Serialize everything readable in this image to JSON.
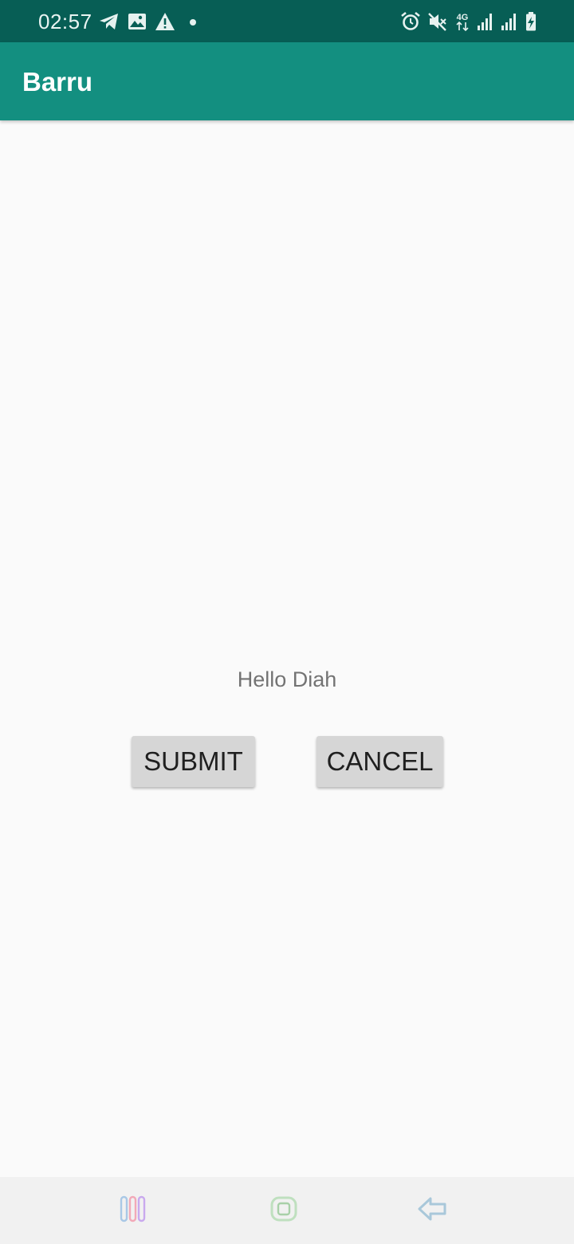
{
  "status_bar": {
    "time": "02:57",
    "network_label": "4G",
    "left_icons": [
      "telegram-icon",
      "image-icon",
      "warning-icon",
      "dot-icon"
    ],
    "right_icons": [
      "alarm-icon",
      "mute-icon",
      "network-4g-icon",
      "signal-icon",
      "signal-icon",
      "battery-charging-icon"
    ]
  },
  "app_bar": {
    "title": "Barru"
  },
  "main": {
    "greeting": "Hello Diah",
    "submit_label": "SUBMIT",
    "cancel_label": "CANCEL"
  },
  "nav_bar": {
    "icons": [
      "recents-icon",
      "home-icon",
      "back-icon"
    ]
  },
  "colors": {
    "status_bar": "#075e55",
    "app_bar": "#138f80",
    "background": "#fafafa",
    "button": "#d6d6d6",
    "nav_bar": "#f1f1f1"
  }
}
